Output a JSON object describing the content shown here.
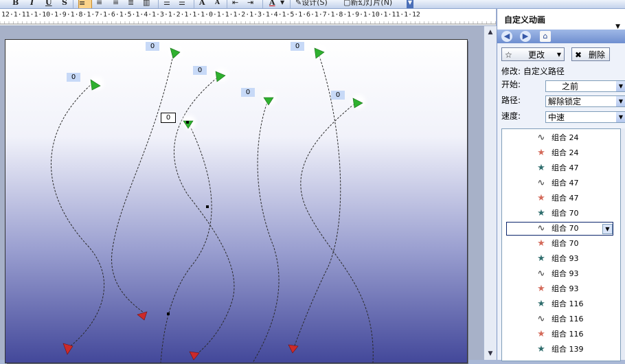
{
  "toolbar": {
    "bold": "B",
    "italic": "I",
    "underline": "U",
    "shadow": "S",
    "font_grow": "A",
    "font_shrink": "A",
    "font_color": "A",
    "design_label": "设计(S)",
    "new_slide_label": "新幻灯片(N)"
  },
  "ruler": {
    "text": "12·1·11·1·10·1·9·1·8·1·7·1·6·1·5·1·4·1·3·1·2·1·1·1·0·1·1·1·2·1·3·1·4·1·5·1·6·1·7·1·8·1·9·1·10·1·11·1·12"
  },
  "slide": {
    "tags": [
      "0",
      "0",
      "0",
      "0",
      "0",
      "0",
      "0",
      "0"
    ],
    "colors": {
      "start_marker": "#2fb02f",
      "end_marker": "#cc2a2a",
      "tag_bg": "#c7d9f7"
    }
  },
  "taskpane": {
    "title": "自定义动画",
    "change_button": "更改",
    "delete_button": "删除",
    "modify_label": "修改: 自定义路径",
    "start_label": "开始:",
    "start_value": "之前",
    "path_label": "路径:",
    "path_value": "解除锁定",
    "speed_label": "速度:",
    "speed_value": "中速",
    "list": [
      {
        "icon": "path-icon",
        "label": "组合 24"
      },
      {
        "icon": "star-icon",
        "color": "#d46a5a",
        "label": "组合 24"
      },
      {
        "icon": "star-icon",
        "color": "#2f6d6d",
        "label": "组合 47"
      },
      {
        "icon": "path-icon",
        "label": "组合 47"
      },
      {
        "icon": "star-icon",
        "color": "#d46a5a",
        "label": "组合 47"
      },
      {
        "icon": "star-icon",
        "color": "#2f6d6d",
        "label": "组合 70"
      },
      {
        "icon": "path-icon",
        "label": "组合 70",
        "selected": true
      },
      {
        "icon": "star-icon",
        "color": "#d46a5a",
        "label": "组合 70"
      },
      {
        "icon": "star-icon",
        "color": "#2f6d6d",
        "label": "组合 93"
      },
      {
        "icon": "path-icon",
        "label": "组合 93"
      },
      {
        "icon": "star-icon",
        "color": "#d46a5a",
        "label": "组合 93"
      },
      {
        "icon": "star-icon",
        "color": "#2f6d6d",
        "label": "组合 116"
      },
      {
        "icon": "path-icon",
        "label": "组合 116"
      },
      {
        "icon": "star-icon",
        "color": "#d46a5a",
        "label": "组合 116"
      },
      {
        "icon": "star-icon",
        "color": "#2f6d6d",
        "label": "组合 139"
      }
    ]
  }
}
